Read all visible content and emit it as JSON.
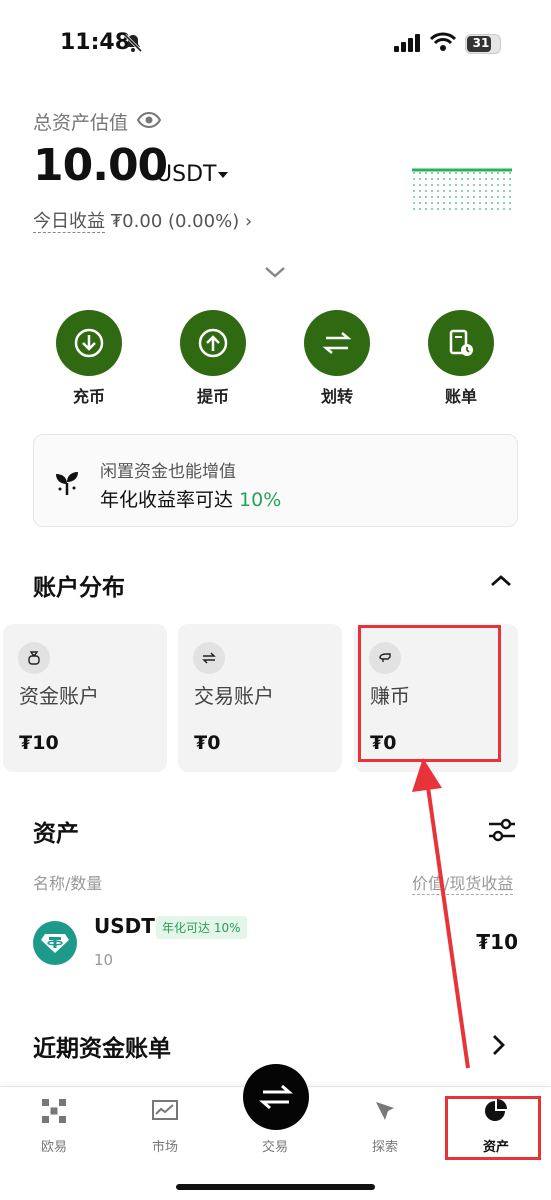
{
  "status_bar": {
    "time": "11:48",
    "battery": "31"
  },
  "total": {
    "label": "总资产估值",
    "amount": "10.00",
    "unit": "USDT",
    "today_label": "今日收益",
    "today_value": "₮0.00 (0.00%)"
  },
  "actions": [
    {
      "label": "充币",
      "icon": "deposit-icon"
    },
    {
      "label": "提币",
      "icon": "withdraw-icon"
    },
    {
      "label": "划转",
      "icon": "transfer-icon"
    },
    {
      "label": "账单",
      "icon": "bill-icon"
    }
  ],
  "promo": {
    "line1": "闲置资金也能增值",
    "line2": "年化收益率可达 ",
    "rate": "10%"
  },
  "accounts": {
    "title": "账户分布",
    "items": [
      {
        "name": "资金账户",
        "value": "₮10"
      },
      {
        "name": "交易账户",
        "value": "₮0"
      },
      {
        "name": "赚币",
        "value": "₮0"
      }
    ]
  },
  "assets": {
    "title": "资产",
    "col_left": "名称/数量",
    "col_right": "价值/现货收益",
    "rows": [
      {
        "symbol": "USDT",
        "badge": "年化可达 10%",
        "qty": "10",
        "value": "₮10"
      }
    ]
  },
  "recent_bills": {
    "title": "近期资金账单"
  },
  "bottom_nav": [
    {
      "label": "欧易",
      "icon": "okx-logo-icon"
    },
    {
      "label": "市场",
      "icon": "market-chart-icon"
    },
    {
      "label": "交易",
      "icon": "trade-swap-icon"
    },
    {
      "label": "探索",
      "icon": "explore-compass-icon"
    },
    {
      "label": "资产",
      "icon": "assets-pie-icon"
    }
  ],
  "colors": {
    "accent_green": "#2f6a12",
    "positive": "#26a35a",
    "annotation_red": "#e8333a"
  }
}
